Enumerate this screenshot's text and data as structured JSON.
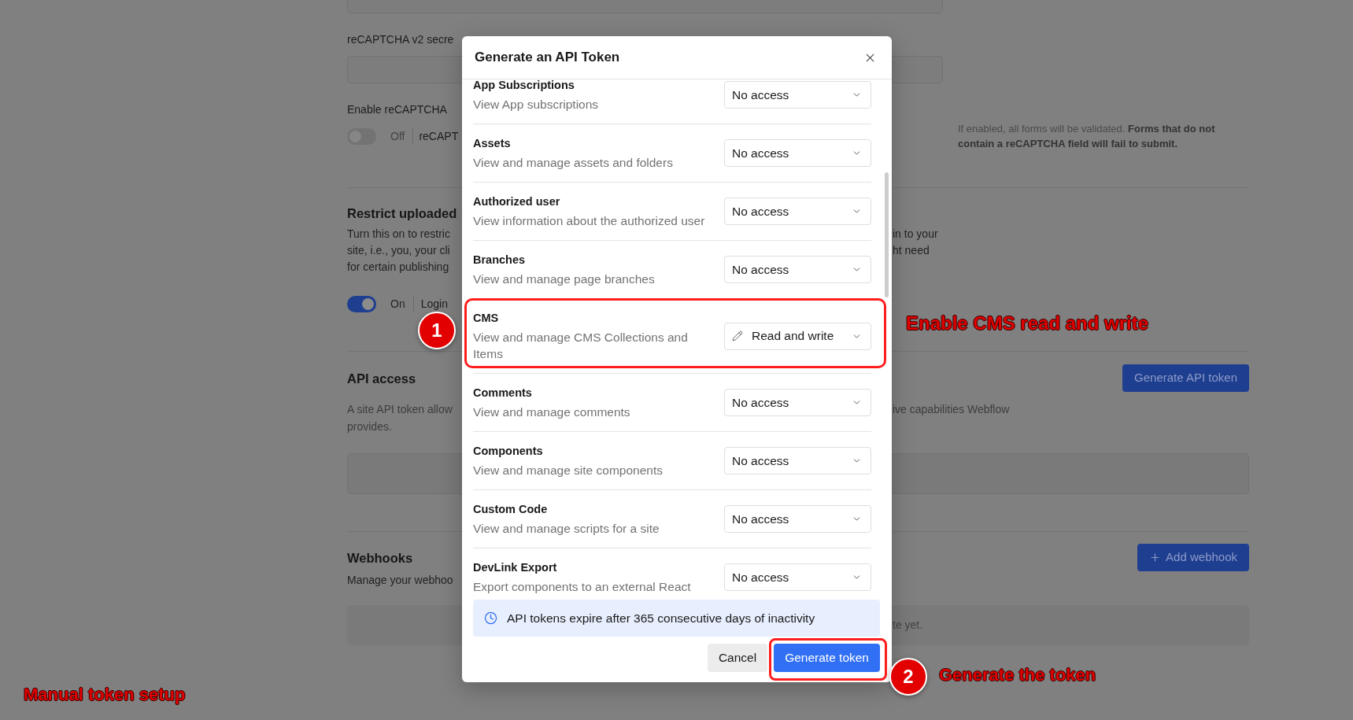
{
  "background": {
    "secret_label": "reCAPTCHA v2 secre",
    "enable_recaptcha": {
      "label": "Enable reCAPTCHA",
      "toggle": {
        "on": false,
        "label": "Off"
      },
      "option": "reCAPT",
      "help": "If enabled, all forms will be validated. **Forms that do not contain a reCAPTCHA field will fail to submit.**"
    },
    "restrict_uploads": {
      "heading": "Restrict uploaded",
      "description_left": [
        "Turn this on to restric",
        "site, i.e., you, your cli",
        "for certain publishing"
      ],
      "description_right": [
        "in to your",
        "ht need"
      ],
      "toggle": {
        "on": true,
        "label": "On"
      },
      "option": "Login"
    },
    "api_access": {
      "heading": "API access",
      "button": "Generate API token",
      "description_left": [
        "A site API token allow",
        "provides."
      ],
      "description_right": [
        "ive capabilities Webflow"
      ]
    },
    "webhooks": {
      "heading": "Webhooks",
      "button": "Add webhook",
      "description": "Manage your webhoo",
      "empty_message": "te yet."
    }
  },
  "dialog": {
    "title": "Generate an API Token",
    "permissions": [
      {
        "name": "App Subscriptions",
        "description": "View App subscriptions",
        "access": "No access",
        "kind": "none",
        "highlighted": false
      },
      {
        "name": "Assets",
        "description": "View and manage assets and folders",
        "access": "No access",
        "kind": "none",
        "highlighted": false
      },
      {
        "name": "Authorized user",
        "description": "View information about the authorized user",
        "access": "No access",
        "kind": "none",
        "highlighted": false
      },
      {
        "name": "Branches",
        "description": "View and manage page branches",
        "access": "No access",
        "kind": "none",
        "highlighted": false
      },
      {
        "name": "CMS",
        "description": "View and manage CMS Collections and Items",
        "access": "Read and write",
        "kind": "write",
        "highlighted": true
      },
      {
        "name": "Comments",
        "description": "View and manage comments",
        "access": "No access",
        "kind": "none",
        "highlighted": false
      },
      {
        "name": "Components",
        "description": "View and manage site components",
        "access": "No access",
        "kind": "none",
        "highlighted": false
      },
      {
        "name": "Custom Code",
        "description": "View and manage scripts for a site",
        "access": "No access",
        "kind": "none",
        "highlighted": false
      },
      {
        "name": "DevLink Export",
        "description": "Export components to an external React",
        "access": "No access",
        "kind": "none",
        "highlighted": false
      }
    ],
    "notice": "API tokens expire after 365 consecutive days of inactivity",
    "buttons": [
      {
        "label": "Cancel",
        "kind": "secondary",
        "highlighted": false
      },
      {
        "label": "Generate token",
        "kind": "primary",
        "highlighted": true
      }
    ]
  },
  "annotations": {
    "steps": [
      {
        "number": "1",
        "text": "Enable CMS read and write"
      },
      {
        "number": "2",
        "text": "Generate the token"
      }
    ],
    "caption": "Manual token setup"
  }
}
